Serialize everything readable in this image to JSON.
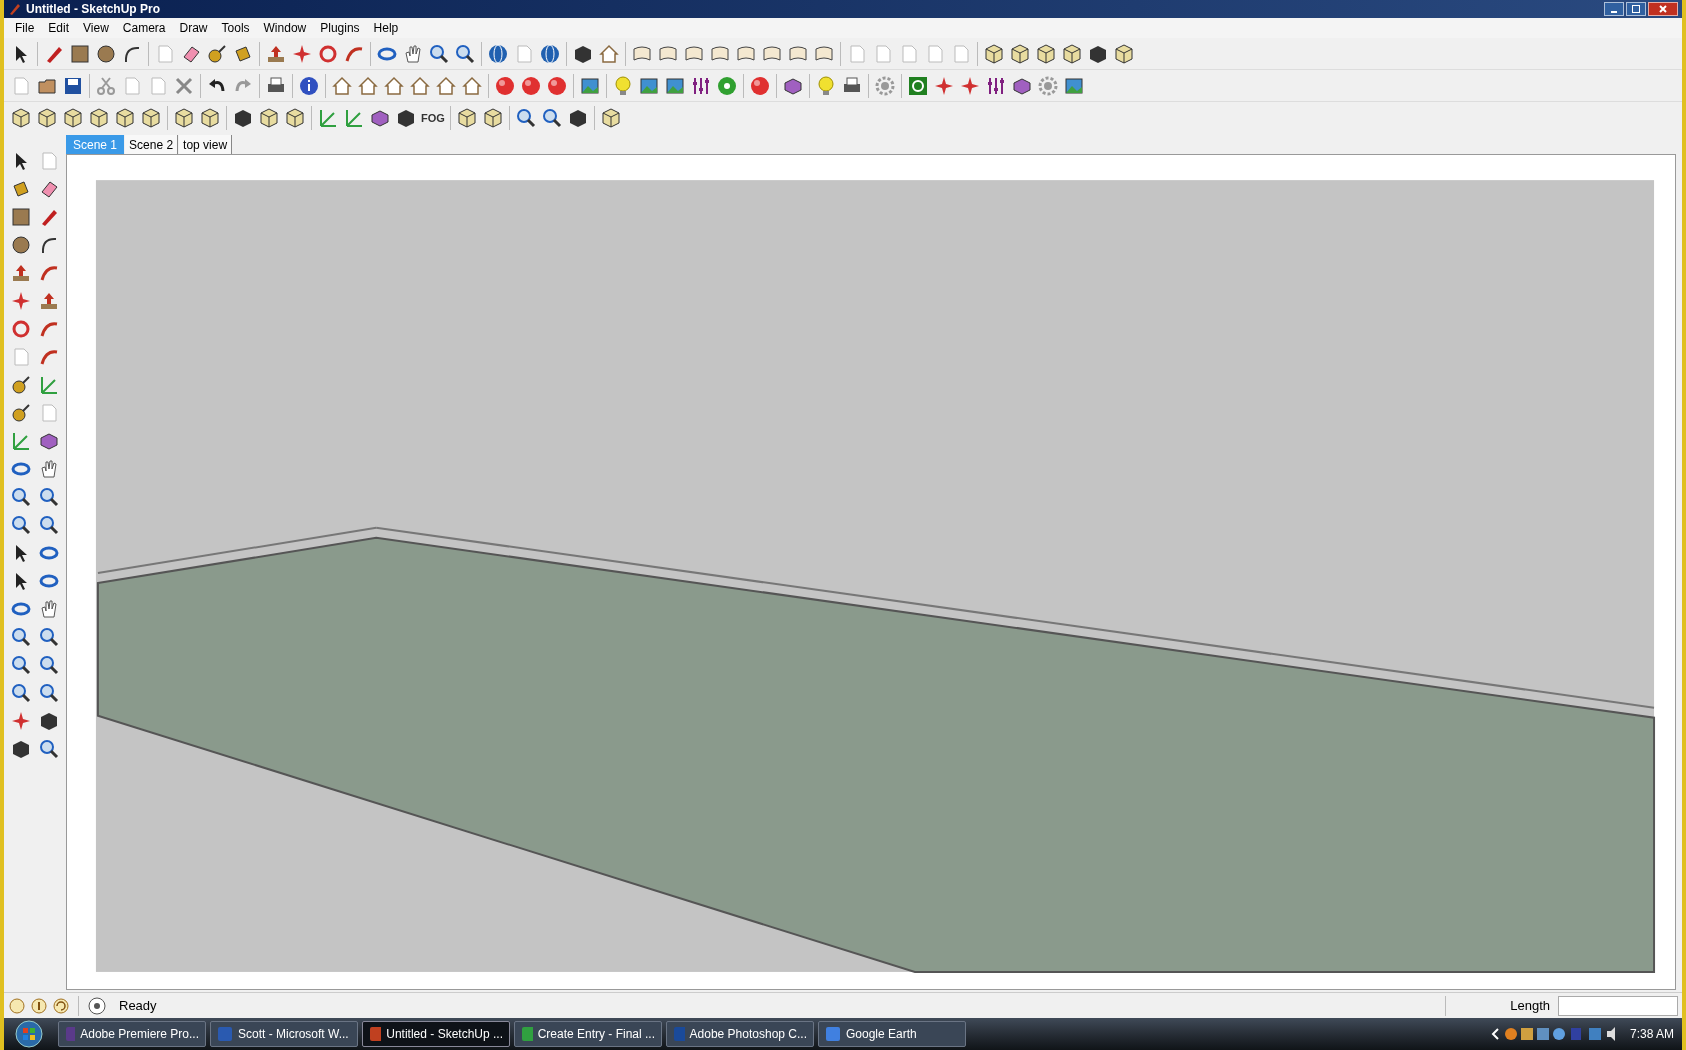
{
  "window": {
    "title": "Untitled - SketchUp Pro"
  },
  "menu": [
    "File",
    "Edit",
    "View",
    "Camera",
    "Draw",
    "Tools",
    "Window",
    "Plugins",
    "Help"
  ],
  "toolbar_text": "FOG",
  "scene_tabs": [
    {
      "label": "Scene 1",
      "selected": true
    },
    {
      "label": "Scene 2",
      "selected": false
    },
    {
      "label": "top view",
      "selected": false
    }
  ],
  "status_bar": {
    "status": "Ready",
    "measurement_label": "Length"
  },
  "taskbar": {
    "tasks": [
      {
        "label": "Adobe Premiere Pro...",
        "kind": "premiere",
        "selected": false
      },
      {
        "label": "Scott - Microsoft W...",
        "kind": "word",
        "selected": false
      },
      {
        "label": "Untitled - SketchUp ...",
        "kind": "sketchup",
        "selected": true
      },
      {
        "label": "Create Entry - Final ...",
        "kind": "browser",
        "selected": false
      },
      {
        "label": "Adobe Photoshop C...",
        "kind": "photoshop",
        "selected": false
      },
      {
        "label": "Google Earth",
        "kind": "earth",
        "selected": false
      }
    ],
    "clock": "7:38 AM"
  }
}
